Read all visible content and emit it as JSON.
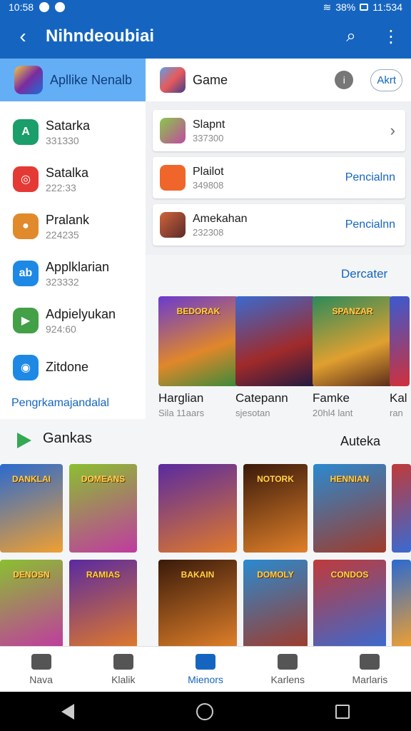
{
  "status_bar": {
    "time": "10:58",
    "battery_text": "38%",
    "clock_right": "11:534"
  },
  "app_bar": {
    "title": "Nihndeoubiai"
  },
  "left_panel": {
    "header_label": "Apllike Nenalb",
    "items": [
      {
        "name": "Satarka",
        "sub": "331330",
        "color": "#1a9e6a",
        "glyph": "A"
      },
      {
        "name": "Satalka",
        "sub": "222:33",
        "color": "#e53935",
        "glyph": "◎"
      },
      {
        "name": "Pralank",
        "sub": "224235",
        "color": "#e08a2c",
        "glyph": "●"
      },
      {
        "name": "Applklarian",
        "sub": "323332",
        "color": "#1e88e5",
        "glyph": "ab"
      },
      {
        "name": "Adpielyukan",
        "sub": "924:60",
        "color": "#43a047",
        "glyph": "▶"
      },
      {
        "name": "Zitdone",
        "sub": "",
        "color": "#1e88e5",
        "glyph": "◉"
      }
    ],
    "link": "Pengrkamajandalal"
  },
  "right_panel": {
    "header_label": "Game",
    "chip_label": "Akrt",
    "cards": [
      {
        "name": "Slapnt",
        "sub": "337300",
        "action": ""
      },
      {
        "name": "Plailot",
        "sub": "349808",
        "action": "Pencialnn"
      },
      {
        "name": "Amekahan",
        "sub": "232308",
        "action": "Pencialnn"
      }
    ]
  },
  "featured": {
    "more_label": "Dercater",
    "tiles": [
      {
        "title": "Harglian",
        "sub": "Sila 11aars",
        "art": "BEDORAK"
      },
      {
        "title": "Catepann",
        "sub": "sjesotan",
        "art": ""
      },
      {
        "title": "Famke",
        "sub": "20hl4 lant",
        "art": "SPANZAR"
      },
      {
        "title": "Kal",
        "sub": "ran",
        "art": ""
      }
    ]
  },
  "games_section": {
    "title": "Gankas",
    "more_label": "Auteka",
    "tiles_row1": [
      "DANKLAI",
      "DOMEANS",
      "",
      "NOTORK",
      "HENNIAN",
      ""
    ],
    "tiles_row2": [
      "DENOSN",
      "RAMIAS",
      "BAKAIN",
      "DOMOLY",
      "CONDOS",
      ""
    ]
  },
  "bottom_nav": {
    "items": [
      {
        "label": "Nava",
        "active": false
      },
      {
        "label": "Klalik",
        "active": false
      },
      {
        "label": "Mienors",
        "active": true
      },
      {
        "label": "Karlens",
        "active": false
      },
      {
        "label": "Marlaris",
        "active": false
      }
    ]
  }
}
